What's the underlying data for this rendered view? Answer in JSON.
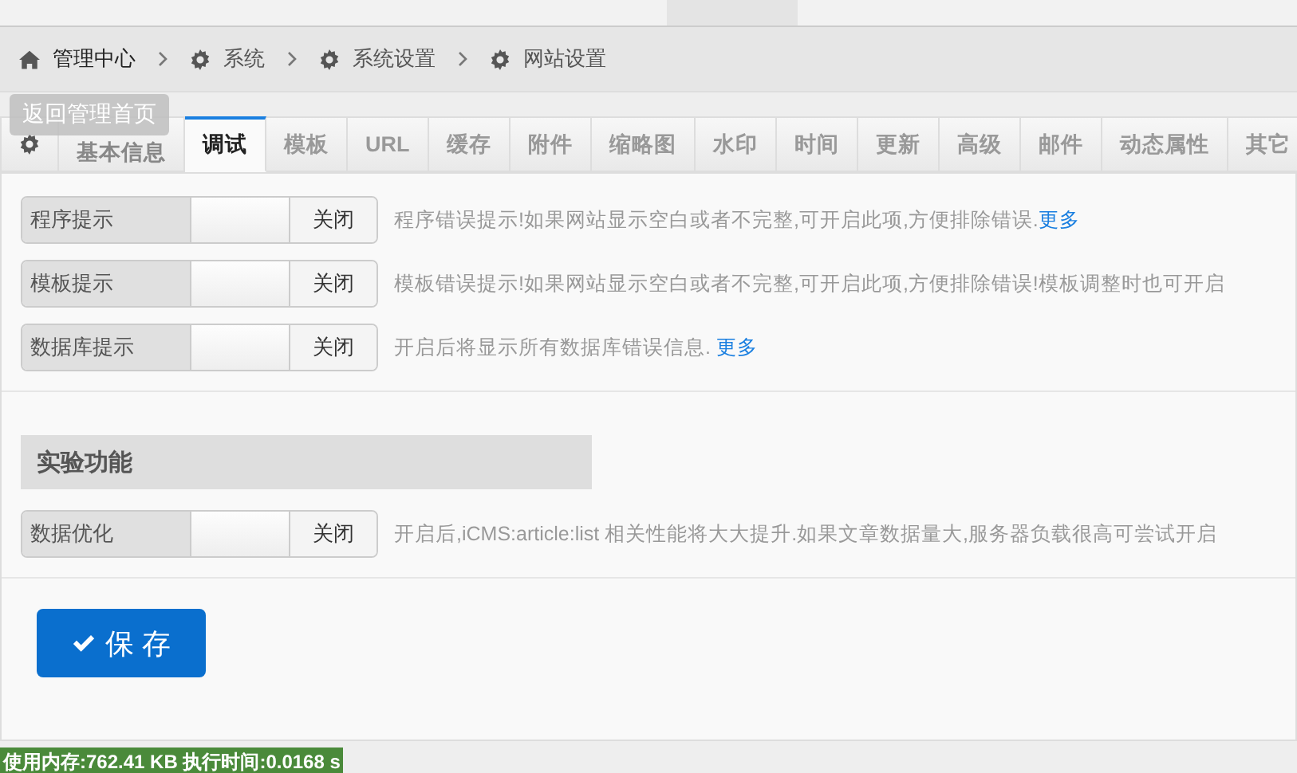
{
  "breadcrumb": [
    {
      "label": "管理中心"
    },
    {
      "label": "系统"
    },
    {
      "label": "系统设置"
    },
    {
      "label": "网站设置"
    }
  ],
  "tooltip": "返回管理首页",
  "tabs": [
    {
      "kind": "icon",
      "selected": false
    },
    {
      "label": "基本信息",
      "kind": "text",
      "selected": false
    },
    {
      "label": "调试",
      "kind": "text",
      "selected": true
    },
    {
      "label": "模板",
      "kind": "text",
      "selected": false
    },
    {
      "label": "URL",
      "kind": "text",
      "selected": false
    },
    {
      "label": "缓存",
      "kind": "text",
      "selected": false
    },
    {
      "label": "附件",
      "kind": "text",
      "selected": false
    },
    {
      "label": "缩略图",
      "kind": "text",
      "selected": false
    },
    {
      "label": "水印",
      "kind": "text",
      "selected": false
    },
    {
      "label": "时间",
      "kind": "text",
      "selected": false
    },
    {
      "label": "更新",
      "kind": "text",
      "selected": false
    },
    {
      "label": "高级",
      "kind": "text",
      "selected": false
    },
    {
      "label": "邮件",
      "kind": "text",
      "selected": false
    },
    {
      "label": "动态属性",
      "kind": "text",
      "selected": false
    },
    {
      "label": "其它",
      "kind": "text",
      "selected": false
    }
  ],
  "settings": [
    {
      "label": "程序提示",
      "on": false,
      "state_label": "关闭",
      "description": "程序错误提示!如果网站显示空白或者不完整,可开启此项,方便排除错误.",
      "link": "更多"
    },
    {
      "label": "模板提示",
      "on": false,
      "state_label": "关闭",
      "description": "模板错误提示!如果网站显示空白或者不完整,可开启此项,方便排除错误!模板调整时也可开启"
    },
    {
      "label": "数据库提示",
      "on": false,
      "state_label": "关闭",
      "description": "开启后将显示所有数据库错误信息. ",
      "link": "更多"
    }
  ],
  "section_title": "实验功能",
  "experimental": [
    {
      "label": "数据优化",
      "on": false,
      "state_label": "关闭",
      "description": "开启后,iCMS:article:list 相关性能将大大提升.如果文章数据量大,服务器负载很高可尝试开启"
    }
  ],
  "save_button": "保 存",
  "footer": "使用内存:762.41 KB 执行时间:0.0168 s"
}
